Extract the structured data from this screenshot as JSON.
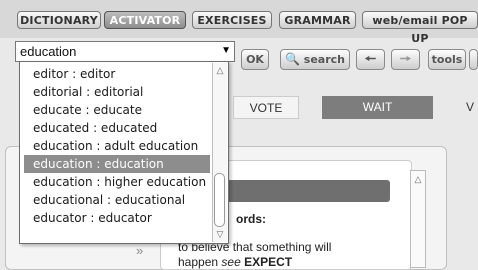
{
  "tabs": [
    {
      "label": "DICTIONARY",
      "active": false
    },
    {
      "label": "ACTIVATOR",
      "active": true
    },
    {
      "label": "EXERCISES",
      "active": false
    },
    {
      "label": "GRAMMAR",
      "active": false
    },
    {
      "label": "web/email POP UP",
      "active": false
    }
  ],
  "search": {
    "value": "education",
    "ok_label": "OK",
    "search_label": "search",
    "tools_label": "tools"
  },
  "dropdown": {
    "items": [
      "editor : editor",
      "editorial : editorial",
      "educate : educate",
      "educated : educated",
      "education : adult education",
      "education : education",
      "education : higher education",
      "educational : educational",
      "educator : educator"
    ],
    "selected_index": 5
  },
  "background": {
    "strip_vote": "VOTE",
    "strip_wait": "WAIT",
    "strip_cut": "V",
    "card_heading_fragment": "ords:",
    "card_line1": "to believe that something will",
    "card_line2_prefix": "happen",
    "card_line2_see": "see",
    "card_line2_link": "EXPECT"
  },
  "colors": {
    "active_tab": "#9a9a9a",
    "selected_option": "#8d8d8d",
    "wait_strip": "#7d7d7d"
  }
}
